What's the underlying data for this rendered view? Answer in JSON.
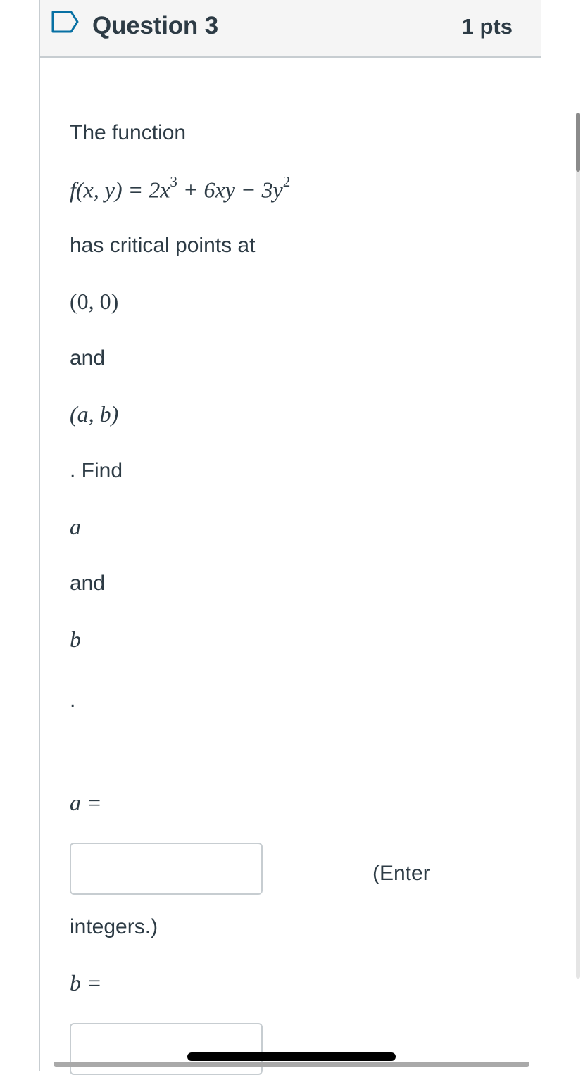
{
  "question": {
    "title": "Question 3",
    "points": "1 pts",
    "flag_icon": "bookmark-flag-icon"
  },
  "body": {
    "intro": "The function",
    "function_prefix": "f(x, y) = 2x",
    "function_exp1": "3",
    "function_mid": " + 6xy − 3y",
    "function_exp2": "2",
    "critical_text": "has critical points at",
    "point1": "(0, 0)",
    "and1": "and",
    "point2": "(a, b)",
    "find_text": ". Find",
    "var_a": "a",
    "and2": "and",
    "var_b": "b",
    "period": ".",
    "a_label": "a =",
    "enter_text": "(Enter",
    "integers_text": "integers.)",
    "b_label": "b ="
  },
  "answers": {
    "a_value": "",
    "b_value": ""
  },
  "colors": {
    "header_bg": "#f5f5f5",
    "border": "#c7cdd1",
    "text": "#2d3b45",
    "flag": "#0770a3"
  }
}
